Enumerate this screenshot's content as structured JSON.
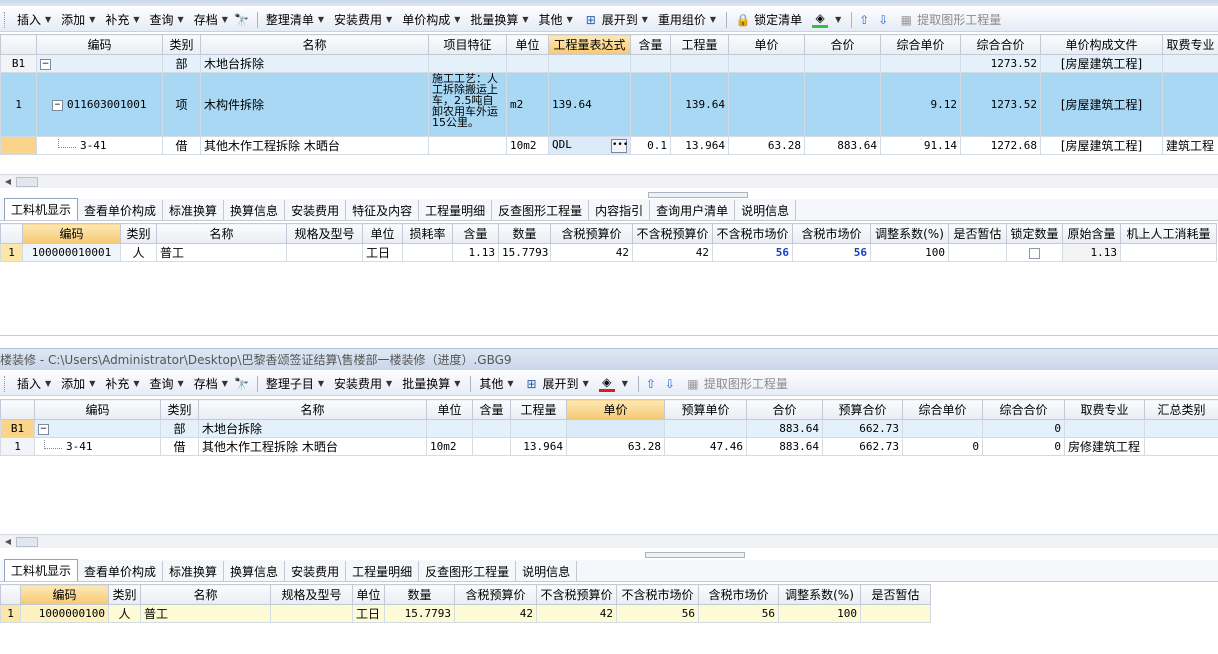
{
  "toolbar1": {
    "items": [
      {
        "label": "插入",
        "dropdown": true
      },
      {
        "label": "添加",
        "dropdown": true
      },
      {
        "label": "补充",
        "dropdown": true
      },
      {
        "label": "查询",
        "dropdown": true
      },
      {
        "label": "存档",
        "dropdown": true
      },
      {
        "label": "整理清单",
        "dropdown": true
      },
      {
        "label": "安装费用",
        "dropdown": true
      },
      {
        "label": "单价构成",
        "dropdown": true
      },
      {
        "label": "批量换算",
        "dropdown": true
      },
      {
        "label": "其他",
        "dropdown": true
      },
      {
        "label": "展开到",
        "dropdown": true
      },
      {
        "label": "重用组价",
        "dropdown": true
      },
      {
        "label": "锁定清单",
        "dropdown": false
      },
      {
        "label": "提取图形工程量",
        "dropdown": false
      }
    ]
  },
  "grid1": {
    "headers": [
      "编码",
      "类别",
      "名称",
      "项目特征",
      "单位",
      "工程量表达式",
      "含量",
      "工程量",
      "单价",
      "合价",
      "综合单价",
      "综合合价",
      "单价构成文件",
      "取费专业"
    ],
    "rows": [
      {
        "row": "B1",
        "code": "",
        "type": "部",
        "name": "木地台拆除",
        "feature": "",
        "unit": "",
        "expr": "",
        "content": "",
        "qty": "",
        "price": "",
        "total": "",
        "comp_price": "",
        "comp_total": "1273.52",
        "file": "[房屋建筑工程]",
        "major": ""
      },
      {
        "row": "1",
        "code": "011603001001",
        "type": "项",
        "name": "木构件拆除",
        "feature": "施工工艺：人工拆除搬运上车，2.5吨自卸农用车外运15公里。",
        "unit": "m2",
        "expr": "139.64",
        "content": "",
        "qty": "139.64",
        "price": "",
        "total": "",
        "comp_price": "9.12",
        "comp_total": "1273.52",
        "file": "[房屋建筑工程]",
        "major": ""
      },
      {
        "row": "",
        "code": "3-41",
        "type": "借",
        "name": "其他木作工程拆除 木晒台",
        "feature": "",
        "unit": "10m2",
        "expr": "QDL",
        "content": "0.1",
        "qty": "13.964",
        "price": "63.28",
        "total": "883.64",
        "comp_price": "91.14",
        "comp_total": "1272.68",
        "file": "[房屋建筑工程]",
        "major": "建筑工程"
      }
    ]
  },
  "tabs1": [
    "工料机显示",
    "查看单价构成",
    "标准换算",
    "换算信息",
    "安装费用",
    "特征及内容",
    "工程量明细",
    "反查图形工程量",
    "内容指引",
    "查询用户清单",
    "说明信息"
  ],
  "grid2": {
    "headers": [
      "编码",
      "类别",
      "名称",
      "规格及型号",
      "单位",
      "损耗率",
      "含量",
      "数量",
      "含税预算价",
      "不含税预算价",
      "不含税市场价",
      "含税市场价",
      "调整系数(%)",
      "是否暂估",
      "锁定数量",
      "原始含量",
      "机上人工消耗量"
    ],
    "rows": [
      {
        "row": "1",
        "code": "100000010001",
        "type": "人",
        "name": "普工",
        "spec": "",
        "unit": "工日",
        "loss": "",
        "content": "1.13",
        "qty": "15.7793",
        "tax_budget": "42",
        "notax_budget": "42",
        "notax_market": "56",
        "tax_market": "56",
        "coef": "100",
        "estimate": "",
        "original": "1.13",
        "machine": ""
      }
    ]
  },
  "window2": {
    "title": "楼装修 - C:\\Users\\Administrator\\Desktop\\巴黎香颂签证结算\\售楼部一楼装修（进度）.GBG9"
  },
  "toolbar2": {
    "items": [
      {
        "label": "插入",
        "dropdown": true
      },
      {
        "label": "添加",
        "dropdown": true
      },
      {
        "label": "补充",
        "dropdown": true
      },
      {
        "label": "查询",
        "dropdown": true
      },
      {
        "label": "存档",
        "dropdown": true
      },
      {
        "label": "整理子目",
        "dropdown": true
      },
      {
        "label": "安装费用",
        "dropdown": true
      },
      {
        "label": "批量换算",
        "dropdown": true
      },
      {
        "label": "其他",
        "dropdown": true
      },
      {
        "label": "展开到",
        "dropdown": true
      },
      {
        "label": "提取图形工程量",
        "dropdown": false
      }
    ]
  },
  "grid3": {
    "headers": [
      "编码",
      "类别",
      "名称",
      "单位",
      "含量",
      "工程量",
      "单价",
      "预算单价",
      "合价",
      "预算合价",
      "综合单价",
      "综合合价",
      "取费专业",
      "汇总类别"
    ],
    "rows": [
      {
        "row": "B1",
        "code": "",
        "type": "部",
        "name": "木地台拆除",
        "unit": "",
        "content": "",
        "qty": "",
        "price": "",
        "budget_price": "",
        "total": "883.64",
        "budget_total": "662.73",
        "comp_price": "",
        "comp_total": "0",
        "major": "",
        "summary": ""
      },
      {
        "row": "1",
        "code": "3-41",
        "type": "借",
        "name": "其他木作工程拆除 木晒台",
        "unit": "10m2",
        "content": "",
        "qty": "13.964",
        "price": "63.28",
        "budget_price": "47.46",
        "total": "883.64",
        "budget_total": "662.73",
        "comp_price": "0",
        "comp_total": "0",
        "major": "房修建筑工程",
        "summary": ""
      }
    ]
  },
  "tabs2": [
    "工料机显示",
    "查看单价构成",
    "标准换算",
    "换算信息",
    "安装费用",
    "工程量明细",
    "反查图形工程量",
    "说明信息"
  ],
  "grid4": {
    "headers": [
      "编码",
      "类别",
      "名称",
      "规格及型号",
      "单位",
      "数量",
      "含税预算价",
      "不含税预算价",
      "不含税市场价",
      "含税市场价",
      "调整系数(%)",
      "是否暂估"
    ],
    "rows": [
      {
        "row": "1",
        "code": "1000000100",
        "type": "人",
        "name": "普工",
        "spec": "",
        "unit": "工日",
        "qty": "15.7793",
        "tax_budget": "42",
        "notax_budget": "42",
        "notax_market": "56",
        "tax_market": "56",
        "coef": "100",
        "estimate": ""
      }
    ]
  }
}
